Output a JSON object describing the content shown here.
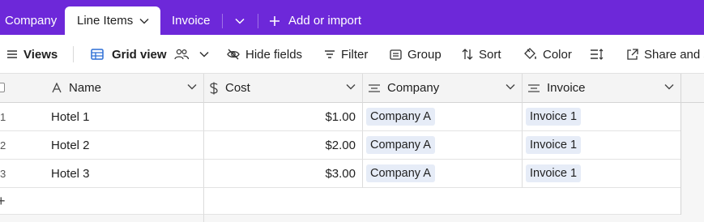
{
  "tabs": {
    "company": "Company",
    "line_items": "Line Items",
    "invoice": "Invoice",
    "add_or_import": "Add or import"
  },
  "toolbar": {
    "views": "Views",
    "grid_view": "Grid view",
    "hide_fields": "Hide fields",
    "filter": "Filter",
    "group": "Group",
    "sort": "Sort",
    "color": "Color",
    "share": "Share and s"
  },
  "columns": {
    "name": "Name",
    "cost": "Cost",
    "company": "Company",
    "invoice": "Invoice"
  },
  "rows": [
    {
      "num": "1",
      "name": "Hotel 1",
      "cost": "$1.00",
      "company": "Company A",
      "invoice": "Invoice 1"
    },
    {
      "num": "2",
      "name": "Hotel 2",
      "cost": "$2.00",
      "company": "Company A",
      "invoice": "Invoice 1"
    },
    {
      "num": "3",
      "name": "Hotel 3",
      "cost": "$3.00",
      "company": "Company A",
      "invoice": "Invoice 1"
    }
  ],
  "colors": {
    "tab_bar": "#6d28d9",
    "chip_bg": "#e6ecf7",
    "grid_icon": "#2d6fd6"
  },
  "icons": {
    "views": "hamburger-icon",
    "grid_view": "grid-icon",
    "collaborators": "people-icon",
    "hide_fields": "eye-slash-icon",
    "filter": "filter-icon",
    "group": "group-icon",
    "sort": "sort-icon",
    "color": "paint-bucket-icon",
    "row_height": "row-height-icon",
    "share": "share-icon",
    "name_field": "text-field-icon",
    "cost_field": "currency-icon",
    "link_field": "linked-record-icon"
  }
}
